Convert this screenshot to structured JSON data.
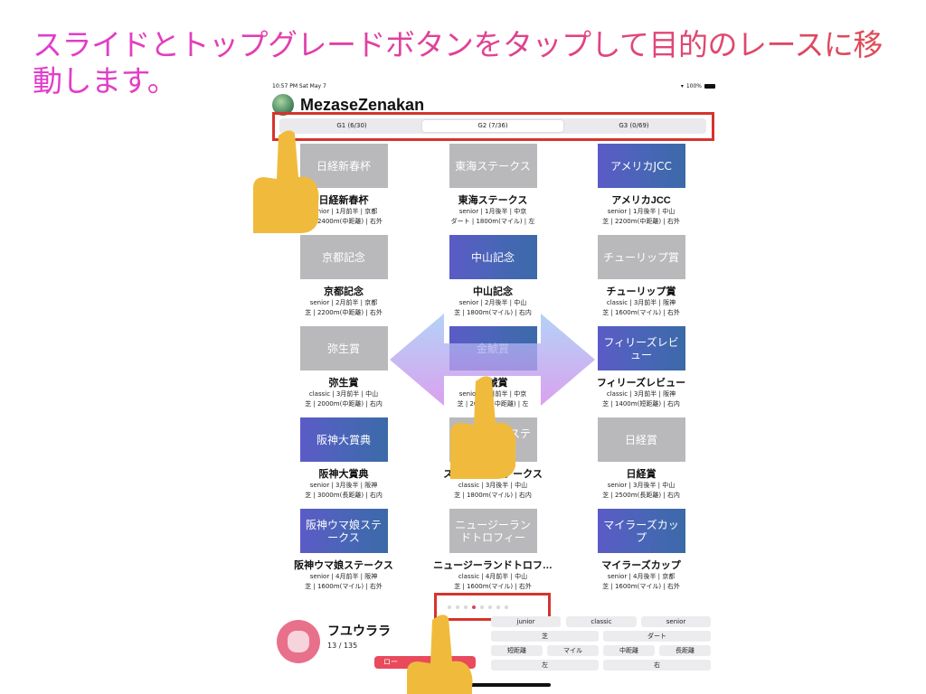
{
  "headline": "スライドとトップグレードボタンをタップして目的のレースに移動します。",
  "status_bar": {
    "time": "10:57 PM  Sat May 7",
    "battery": "100%"
  },
  "app": {
    "title": "MezaseZenakan"
  },
  "grade_tabs": [
    {
      "label": "G1 (6/30)",
      "selected": false
    },
    {
      "label": "G2 (7/36)",
      "selected": true
    },
    {
      "label": "G3 (0/69)",
      "selected": false
    }
  ],
  "races": [
    {
      "thumb": "日経新春杯",
      "name": "日経新春杯",
      "info1": "senior | 1月前半 | 京都",
      "info2": "芝 | 2400m(中距離) | 右外",
      "style": "grey"
    },
    {
      "thumb": "東海ステークス",
      "name": "東海ステークス",
      "info1": "senior | 1月後半 | 中京",
      "info2": "ダート | 1800m(マイル) | 左",
      "style": "grey"
    },
    {
      "thumb": "アメリカJCC",
      "name": "アメリカJCC",
      "info1": "senior | 1月後半 | 中山",
      "info2": "芝 | 2200m(中距離) | 右外",
      "style": "grad"
    },
    {
      "thumb": "京都記念",
      "name": "京都記念",
      "info1": "senior | 2月前半 | 京都",
      "info2": "芝 | 2200m(中距離) | 右外",
      "style": "grey"
    },
    {
      "thumb": "中山記念",
      "name": "中山記念",
      "info1": "senior | 2月後半 | 中山",
      "info2": "芝 | 1800m(マイル) | 右内",
      "style": "grad"
    },
    {
      "thumb": "チューリップ賞",
      "name": "チューリップ賞",
      "info1": "classic | 3月前半 | 阪神",
      "info2": "芝 | 1600m(マイル) | 右外",
      "style": "grey"
    },
    {
      "thumb": "弥生賞",
      "name": "弥生賞",
      "info1": "classic | 3月前半 | 中山",
      "info2": "芝 | 2000m(中距離) | 右内",
      "style": "grey"
    },
    {
      "thumb": "金鯱賞",
      "name": "金鯱賞",
      "info1": "senior | 3月前半 | 中京",
      "info2": "芝 | 2000m(中距離) | 左",
      "style": "grad"
    },
    {
      "thumb": "フィリーズレビュー",
      "name": "フィリーズレビュー",
      "info1": "classic | 3月前半 | 阪神",
      "info2": "芝 | 1400m(短距離) | 右内",
      "style": "grad"
    },
    {
      "thumb": "阪神大賞典",
      "name": "阪神大賞典",
      "info1": "senior | 3月後半 | 阪神",
      "info2": "芝 | 3000m(長距離) | 右内",
      "style": "grad"
    },
    {
      "thumb": "スプリングステークス",
      "name": "スプリングステークス",
      "info1": "classic | 3月後半 | 中山",
      "info2": "芝 | 1800m(マイル) | 右内",
      "style": "grey"
    },
    {
      "thumb": "日経賞",
      "name": "日経賞",
      "info1": "senior | 3月後半 | 中山",
      "info2": "芝 | 2500m(長距離) | 右内",
      "style": "grey"
    },
    {
      "thumb": "阪神ウマ娘ステークス",
      "name": "阪神ウマ娘ステークス",
      "info1": "senior | 4月前半 | 阪神",
      "info2": "芝 | 1600m(マイル) | 右外",
      "style": "grad"
    },
    {
      "thumb": "ニュージーランドトロフィー",
      "name": "ニュージーランドトロフ…",
      "info1": "classic | 4月前半 | 中山",
      "info2": "芝 | 1600m(マイル) | 右外",
      "style": "grey"
    },
    {
      "thumb": "マイラーズカップ",
      "name": "マイラーズカップ",
      "info1": "senior | 4月後半 | 京都",
      "info2": "芝 | 1600m(マイル) | 右外",
      "style": "grad"
    }
  ],
  "pager": {
    "count": 8,
    "active_index": 3
  },
  "trainer": {
    "name": "フユウララ",
    "count": "13 / 135"
  },
  "load_button": "ロー",
  "filters": {
    "era": [
      "junior",
      "classic",
      "senior"
    ],
    "surface": [
      "芝",
      "ダート"
    ],
    "distance": [
      "短距離",
      "マイル",
      "中距離",
      "長距離"
    ],
    "direction": [
      "左",
      "右"
    ]
  },
  "colors": {
    "accent": "#e94a5c",
    "highlight_box": "#d5342c",
    "hand": "#f0bb3c"
  },
  "icons": [
    "pointing-hand-icon",
    "double-arrow-icon",
    "wifi-icon",
    "battery-icon"
  ]
}
